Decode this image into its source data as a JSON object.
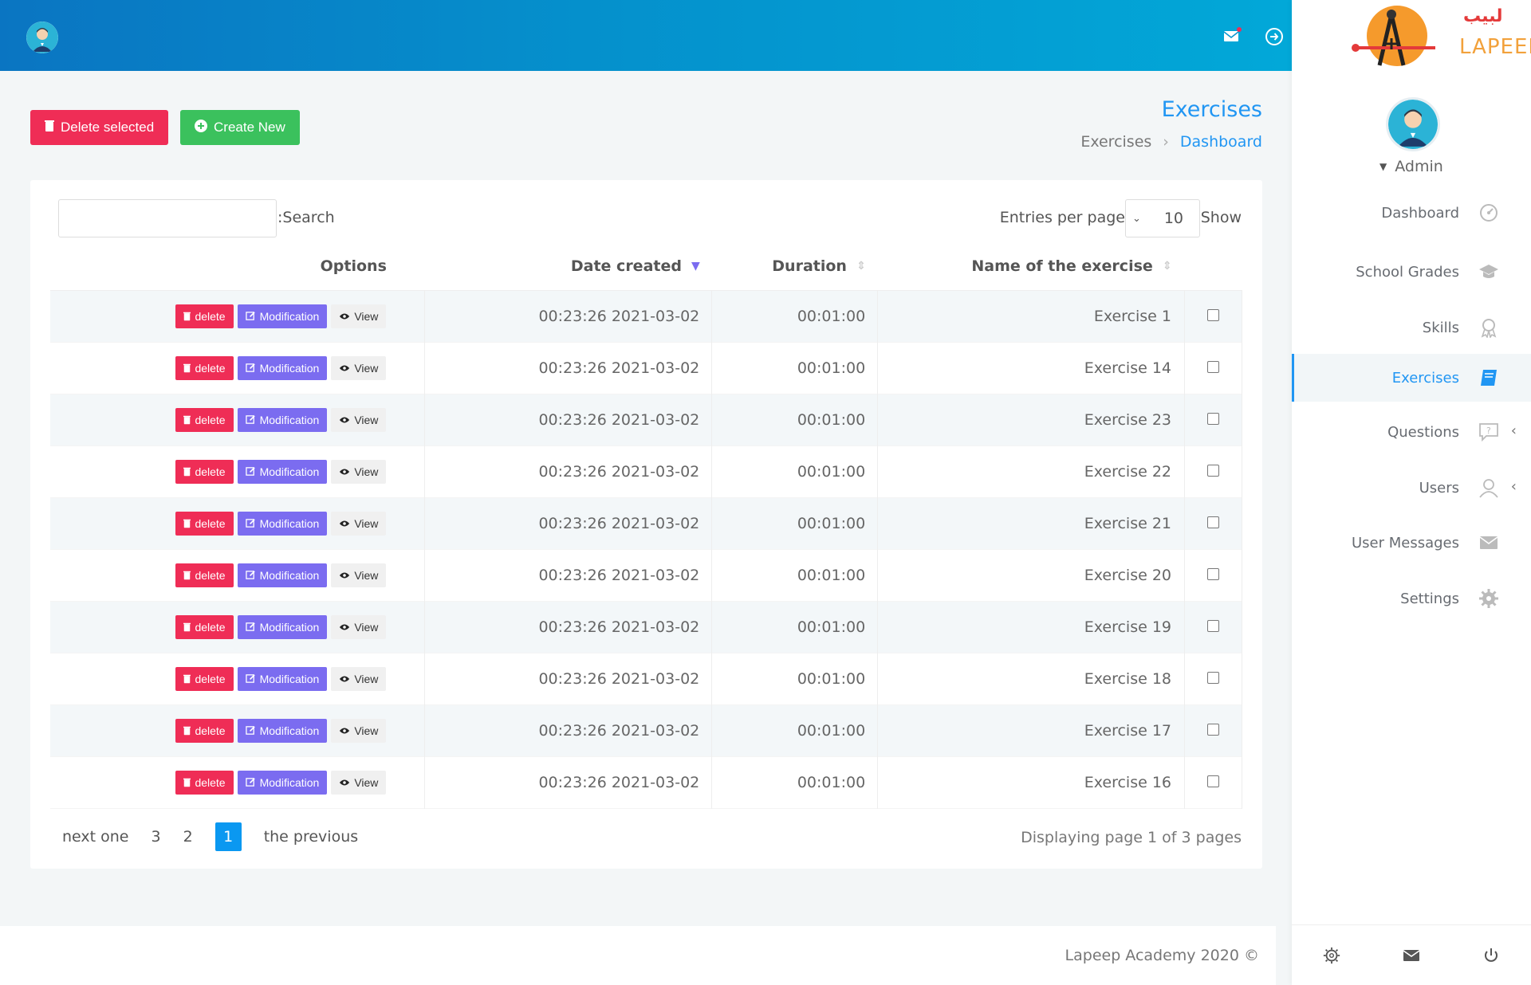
{
  "header": {
    "avatar": "user-avatar-icon",
    "mail_icon": "mail-icon",
    "logout_icon": "logout-icon"
  },
  "sidebar": {
    "logo_text": "LAPEEP",
    "logo_arabic": "لبيب",
    "user_name": "Admin",
    "items": [
      {
        "label": "Dashboard",
        "icon": "gauge-icon",
        "active": false,
        "chevron": false
      },
      {
        "label": "School Grades",
        "icon": "graduation-cap-icon",
        "active": false,
        "chevron": false
      },
      {
        "label": "Skills",
        "icon": "award-icon",
        "active": false,
        "chevron": false
      },
      {
        "label": "Exercises",
        "icon": "book-icon",
        "active": true,
        "chevron": false
      },
      {
        "label": "Questions",
        "icon": "question-icon",
        "active": false,
        "chevron": true
      },
      {
        "label": "Users",
        "icon": "users-icon",
        "active": false,
        "chevron": true
      },
      {
        "label": "User Messages",
        "icon": "envelope-icon",
        "active": false,
        "chevron": false
      },
      {
        "label": "Settings",
        "icon": "gear-icon",
        "active": false,
        "chevron": false
      }
    ],
    "footer_icons": [
      "gear-icon",
      "mail-icon",
      "power-icon"
    ]
  },
  "page": {
    "title": "Exercises",
    "breadcrumb_current": "Exercises",
    "breadcrumb_link": "Dashboard",
    "delete_selected_label": "Delete selected",
    "create_new_label": "Create New"
  },
  "table_controls": {
    "search_label": ":Search",
    "search_value": "",
    "entries_label": "Entries per page",
    "entries_value": "10",
    "show_label": "Show"
  },
  "table": {
    "headers": {
      "options": "Options",
      "date_created": "Date created",
      "duration": "Duration",
      "name": "Name of the exercise"
    },
    "actions": {
      "delete": "delete",
      "modify": "Modification",
      "view": "View"
    },
    "rows": [
      {
        "date": "00:23:26 2021-03-02",
        "duration": "00:01:00",
        "name": "Exercise 1"
      },
      {
        "date": "00:23:26 2021-03-02",
        "duration": "00:01:00",
        "name": "Exercise 14"
      },
      {
        "date": "00:23:26 2021-03-02",
        "duration": "00:01:00",
        "name": "Exercise 23"
      },
      {
        "date": "00:23:26 2021-03-02",
        "duration": "00:01:00",
        "name": "Exercise 22"
      },
      {
        "date": "00:23:26 2021-03-02",
        "duration": "00:01:00",
        "name": "Exercise 21"
      },
      {
        "date": "00:23:26 2021-03-02",
        "duration": "00:01:00",
        "name": "Exercise 20"
      },
      {
        "date": "00:23:26 2021-03-02",
        "duration": "00:01:00",
        "name": "Exercise 19"
      },
      {
        "date": "00:23:26 2021-03-02",
        "duration": "00:01:00",
        "name": "Exercise 18"
      },
      {
        "date": "00:23:26 2021-03-02",
        "duration": "00:01:00",
        "name": "Exercise 17"
      },
      {
        "date": "00:23:26 2021-03-02",
        "duration": "00:01:00",
        "name": "Exercise 16"
      }
    ]
  },
  "pagination": {
    "next_label": "next one",
    "pages": [
      "3",
      "2",
      "1"
    ],
    "current_page": "1",
    "prev_label": "the previous",
    "info": "Displaying page 1 of 3 pages"
  },
  "footer": {
    "text": "Lapeep Academy 2020 ©"
  },
  "colors": {
    "accent": "#2196f3",
    "danger": "#ef2d56",
    "success": "#3bc15d",
    "modify": "#7b6cf0"
  }
}
